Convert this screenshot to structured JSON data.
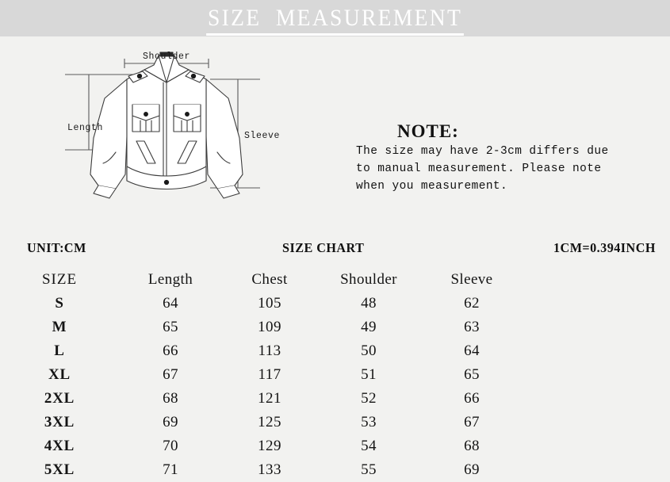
{
  "header": {
    "title": "SIZE  MEASUREMENT",
    "band_color": "#d8d8d8",
    "title_color": "#ffffff"
  },
  "page": {
    "background_color": "#f2f2f0",
    "text_color": "#141414"
  },
  "diagram": {
    "garment": "jacket",
    "labels": {
      "shoulder": "Shoulder",
      "length": "Length",
      "sleeve": "Sleeve"
    }
  },
  "note": {
    "heading": "NOTE:",
    "lines": [
      "The size may have 2-3cm differs due",
      "to manual measurement. Please note",
      "when you measurement."
    ]
  },
  "meta": {
    "unit": "UNIT:CM",
    "chart_title": "SIZE CHART",
    "conversion": "1CM=0.394INCH"
  },
  "table": {
    "headers": [
      "SIZE",
      "Length",
      "Chest",
      "Shoulder",
      "Sleeve"
    ],
    "rows": [
      {
        "size": "S",
        "length": "64",
        "chest": "105",
        "shoulder": "48",
        "sleeve": "62"
      },
      {
        "size": "M",
        "length": "65",
        "chest": "109",
        "shoulder": "49",
        "sleeve": "63"
      },
      {
        "size": "L",
        "length": "66",
        "chest": "113",
        "shoulder": "50",
        "sleeve": "64"
      },
      {
        "size": "XL",
        "length": "67",
        "chest": "117",
        "shoulder": "51",
        "sleeve": "65"
      },
      {
        "size": "2XL",
        "length": "68",
        "chest": "121",
        "shoulder": "52",
        "sleeve": "66"
      },
      {
        "size": "3XL",
        "length": "69",
        "chest": "125",
        "shoulder": "53",
        "sleeve": "67"
      },
      {
        "size": "4XL",
        "length": "70",
        "chest": "129",
        "shoulder": "54",
        "sleeve": "68"
      },
      {
        "size": "5XL",
        "length": "71",
        "chest": "133",
        "shoulder": "55",
        "sleeve": "69"
      }
    ]
  }
}
